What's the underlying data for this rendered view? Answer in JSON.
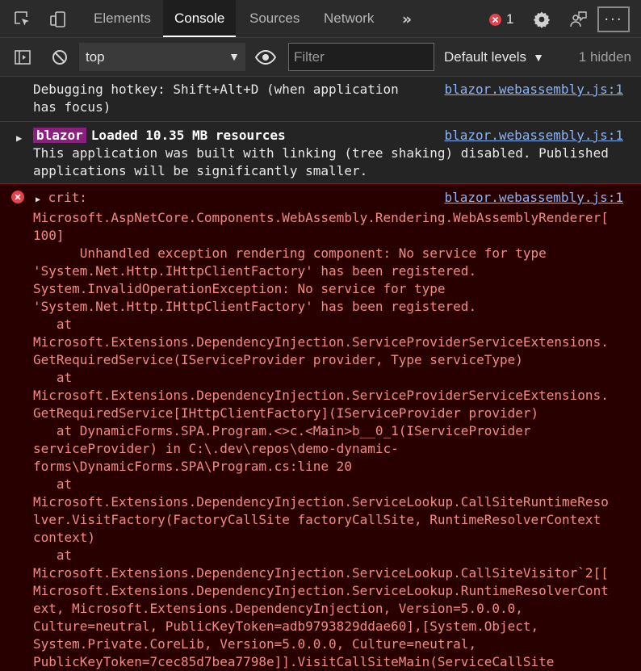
{
  "tabs": [
    {
      "label": "Elements"
    },
    {
      "label": "Console"
    },
    {
      "label": "Sources"
    },
    {
      "label": "Network"
    }
  ],
  "error_count": "1",
  "toolbar": {
    "context": "top",
    "filter_placeholder": "Filter",
    "levels_label": "Default levels",
    "hidden_label": "1 hidden"
  },
  "messages": [
    {
      "text": "Debugging hotkey: Shift+Alt+D (when application\nhas focus)",
      "source": "blazor.webassembly.js:1"
    },
    {
      "badge": "blazor",
      "title": "Loaded 10.35 MB resources",
      "text": "This application was built with linking (tree shaking) disabled. Published\napplications will be significantly smaller.",
      "source": "blazor.webassembly.js:1"
    },
    {
      "level": "crit:",
      "text": "Microsoft.AspNetCore.Components.WebAssembly.Rendering.WebAssemblyRenderer[\n100]\n      Unhandled exception rendering component: No service for type\n'System.Net.Http.IHttpClientFactory' has been registered.\nSystem.InvalidOperationException: No service for type\n'System.Net.Http.IHttpClientFactory' has been registered.\n   at\nMicrosoft.Extensions.DependencyInjection.ServiceProviderServiceExtensions.\nGetRequiredService(IServiceProvider provider, Type serviceType)\n   at\nMicrosoft.Extensions.DependencyInjection.ServiceProviderServiceExtensions.\nGetRequiredService[IHttpClientFactory](IServiceProvider provider)\n   at DynamicForms.SPA.Program.<>c.<Main>b__0_1(IServiceProvider\nserviceProvider) in C:\\.dev\\repos\\demo-dynamic-\nforms\\DynamicForms.SPA\\Program.cs:line 20\n   at\nMicrosoft.Extensions.DependencyInjection.ServiceLookup.CallSiteRuntimeReso\nlver.VisitFactory(FactoryCallSite factoryCallSite, RuntimeResolverContext\ncontext)\n   at\nMicrosoft.Extensions.DependencyInjection.ServiceLookup.CallSiteVisitor`2[[\nMicrosoft.Extensions.DependencyInjection.ServiceLookup.RuntimeResolverCont\next, Microsoft.Extensions.DependencyInjection, Version=5.0.0.0,\nCulture=neutral, PublicKeyToken=adb9793829ddae60],[System.Object,\nSystem.Private.CoreLib, Version=5.0.0.0, Culture=neutral,\nPublicKeyToken=7cec85d7bea7798e]].VisitCallSiteMain(ServiceCallSite\ncallSite, RuntimeResolverContext argument)",
      "source": "blazor.webassembly.js:1"
    }
  ]
}
